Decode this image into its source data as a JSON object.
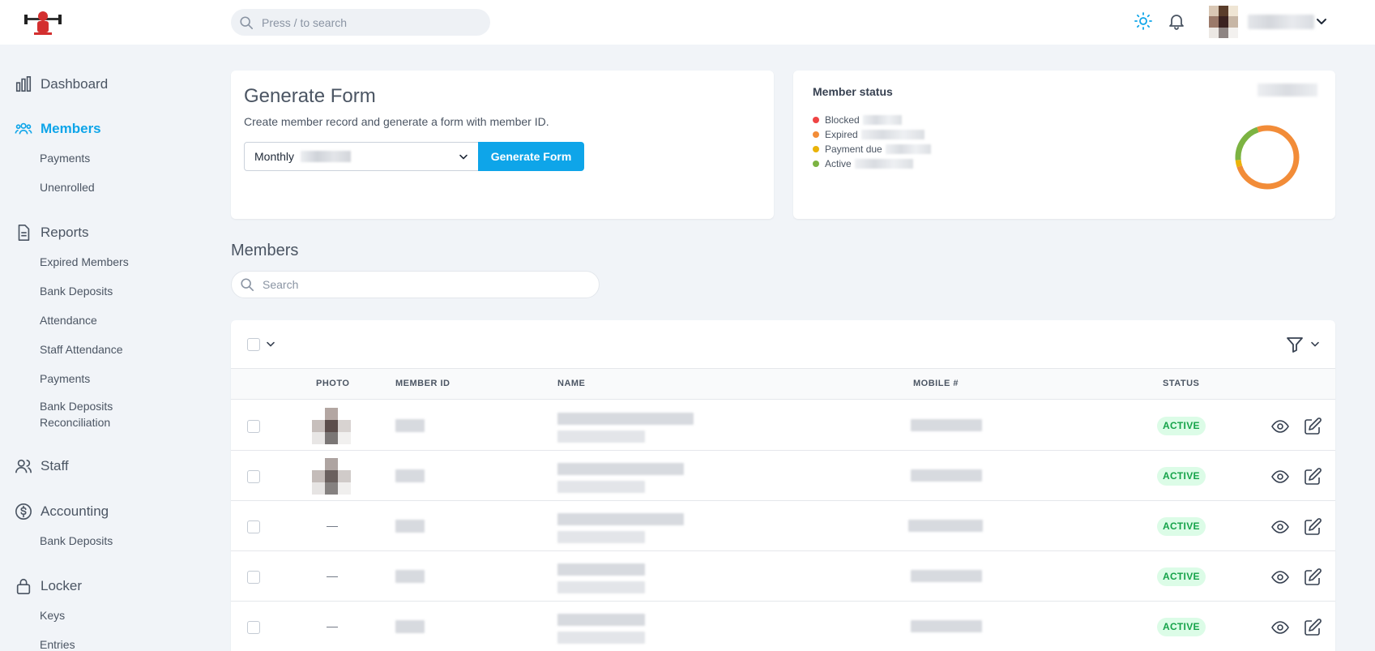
{
  "header": {
    "search_placeholder": "Press / to search"
  },
  "sidebar": {
    "items": [
      {
        "label": "Dashboard",
        "icon": "chart-bar-icon"
      },
      {
        "label": "Members",
        "icon": "users-icon",
        "active": true,
        "children": [
          "Payments",
          "Unenrolled"
        ]
      },
      {
        "label": "Reports",
        "icon": "document-icon",
        "children": [
          "Expired Members",
          "Bank Deposits",
          "Attendance",
          "Staff Attendance",
          "Payments",
          "Bank Deposits Reconciliation"
        ]
      },
      {
        "label": "Staff",
        "icon": "user-icon"
      },
      {
        "label": "Accounting",
        "icon": "dollar-circle-icon",
        "children": [
          "Bank Deposits"
        ]
      },
      {
        "label": "Locker",
        "icon": "lock-icon",
        "children": [
          "Keys",
          "Entries"
        ]
      }
    ]
  },
  "generate_form": {
    "title": "Generate Form",
    "subtitle": "Create member record and generate a form with member ID.",
    "plan_value": "Monthly",
    "button_label": "Generate Form"
  },
  "member_status": {
    "title": "Member status",
    "legend": [
      {
        "label": "Blocked",
        "color": "#ef4444"
      },
      {
        "label": "Expired",
        "color": "#f28c38"
      },
      {
        "label": "Payment due",
        "color": "#eab308"
      },
      {
        "label": "Active",
        "color": "#7cb342"
      }
    ]
  },
  "members": {
    "title": "Members",
    "search_placeholder": "Search",
    "columns": [
      "PHOTO",
      "MEMBER ID",
      "NAME",
      "MOBILE #",
      "STATUS"
    ],
    "rows": [
      {
        "photo": "image",
        "status": "ACTIVE"
      },
      {
        "photo": "image",
        "status": "ACTIVE"
      },
      {
        "photo": "—",
        "status": "ACTIVE"
      },
      {
        "photo": "—",
        "status": "ACTIVE"
      },
      {
        "photo": "—",
        "status": "ACTIVE"
      }
    ]
  },
  "colors": {
    "accent": "#0ea5e9",
    "active_badge_bg": "#dcfce7",
    "active_badge_text": "#16a34a"
  }
}
